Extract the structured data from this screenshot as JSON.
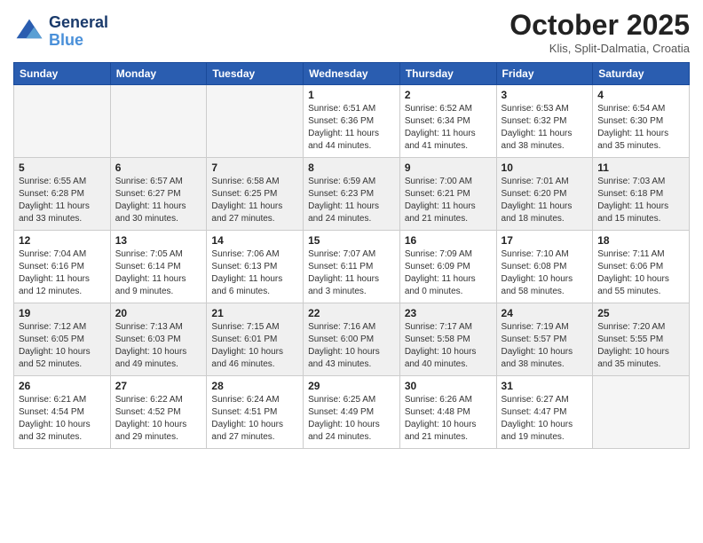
{
  "header": {
    "logo_line1": "General",
    "logo_line2": "Blue",
    "month_title": "October 2025",
    "location": "Klis, Split-Dalmatia, Croatia"
  },
  "days_of_week": [
    "Sunday",
    "Monday",
    "Tuesday",
    "Wednesday",
    "Thursday",
    "Friday",
    "Saturday"
  ],
  "weeks": [
    [
      {
        "day": "",
        "info": ""
      },
      {
        "day": "",
        "info": ""
      },
      {
        "day": "",
        "info": ""
      },
      {
        "day": "1",
        "info": "Sunrise: 6:51 AM\nSunset: 6:36 PM\nDaylight: 11 hours\nand 44 minutes."
      },
      {
        "day": "2",
        "info": "Sunrise: 6:52 AM\nSunset: 6:34 PM\nDaylight: 11 hours\nand 41 minutes."
      },
      {
        "day": "3",
        "info": "Sunrise: 6:53 AM\nSunset: 6:32 PM\nDaylight: 11 hours\nand 38 minutes."
      },
      {
        "day": "4",
        "info": "Sunrise: 6:54 AM\nSunset: 6:30 PM\nDaylight: 11 hours\nand 35 minutes."
      }
    ],
    [
      {
        "day": "5",
        "info": "Sunrise: 6:55 AM\nSunset: 6:28 PM\nDaylight: 11 hours\nand 33 minutes."
      },
      {
        "day": "6",
        "info": "Sunrise: 6:57 AM\nSunset: 6:27 PM\nDaylight: 11 hours\nand 30 minutes."
      },
      {
        "day": "7",
        "info": "Sunrise: 6:58 AM\nSunset: 6:25 PM\nDaylight: 11 hours\nand 27 minutes."
      },
      {
        "day": "8",
        "info": "Sunrise: 6:59 AM\nSunset: 6:23 PM\nDaylight: 11 hours\nand 24 minutes."
      },
      {
        "day": "9",
        "info": "Sunrise: 7:00 AM\nSunset: 6:21 PM\nDaylight: 11 hours\nand 21 minutes."
      },
      {
        "day": "10",
        "info": "Sunrise: 7:01 AM\nSunset: 6:20 PM\nDaylight: 11 hours\nand 18 minutes."
      },
      {
        "day": "11",
        "info": "Sunrise: 7:03 AM\nSunset: 6:18 PM\nDaylight: 11 hours\nand 15 minutes."
      }
    ],
    [
      {
        "day": "12",
        "info": "Sunrise: 7:04 AM\nSunset: 6:16 PM\nDaylight: 11 hours\nand 12 minutes."
      },
      {
        "day": "13",
        "info": "Sunrise: 7:05 AM\nSunset: 6:14 PM\nDaylight: 11 hours\nand 9 minutes."
      },
      {
        "day": "14",
        "info": "Sunrise: 7:06 AM\nSunset: 6:13 PM\nDaylight: 11 hours\nand 6 minutes."
      },
      {
        "day": "15",
        "info": "Sunrise: 7:07 AM\nSunset: 6:11 PM\nDaylight: 11 hours\nand 3 minutes."
      },
      {
        "day": "16",
        "info": "Sunrise: 7:09 AM\nSunset: 6:09 PM\nDaylight: 11 hours\nand 0 minutes."
      },
      {
        "day": "17",
        "info": "Sunrise: 7:10 AM\nSunset: 6:08 PM\nDaylight: 10 hours\nand 58 minutes."
      },
      {
        "day": "18",
        "info": "Sunrise: 7:11 AM\nSunset: 6:06 PM\nDaylight: 10 hours\nand 55 minutes."
      }
    ],
    [
      {
        "day": "19",
        "info": "Sunrise: 7:12 AM\nSunset: 6:05 PM\nDaylight: 10 hours\nand 52 minutes."
      },
      {
        "day": "20",
        "info": "Sunrise: 7:13 AM\nSunset: 6:03 PM\nDaylight: 10 hours\nand 49 minutes."
      },
      {
        "day": "21",
        "info": "Sunrise: 7:15 AM\nSunset: 6:01 PM\nDaylight: 10 hours\nand 46 minutes."
      },
      {
        "day": "22",
        "info": "Sunrise: 7:16 AM\nSunset: 6:00 PM\nDaylight: 10 hours\nand 43 minutes."
      },
      {
        "day": "23",
        "info": "Sunrise: 7:17 AM\nSunset: 5:58 PM\nDaylight: 10 hours\nand 40 minutes."
      },
      {
        "day": "24",
        "info": "Sunrise: 7:19 AM\nSunset: 5:57 PM\nDaylight: 10 hours\nand 38 minutes."
      },
      {
        "day": "25",
        "info": "Sunrise: 7:20 AM\nSunset: 5:55 PM\nDaylight: 10 hours\nand 35 minutes."
      }
    ],
    [
      {
        "day": "26",
        "info": "Sunrise: 6:21 AM\nSunset: 4:54 PM\nDaylight: 10 hours\nand 32 minutes."
      },
      {
        "day": "27",
        "info": "Sunrise: 6:22 AM\nSunset: 4:52 PM\nDaylight: 10 hours\nand 29 minutes."
      },
      {
        "day": "28",
        "info": "Sunrise: 6:24 AM\nSunset: 4:51 PM\nDaylight: 10 hours\nand 27 minutes."
      },
      {
        "day": "29",
        "info": "Sunrise: 6:25 AM\nSunset: 4:49 PM\nDaylight: 10 hours\nand 24 minutes."
      },
      {
        "day": "30",
        "info": "Sunrise: 6:26 AM\nSunset: 4:48 PM\nDaylight: 10 hours\nand 21 minutes."
      },
      {
        "day": "31",
        "info": "Sunrise: 6:27 AM\nSunset: 4:47 PM\nDaylight: 10 hours\nand 19 minutes."
      },
      {
        "day": "",
        "info": ""
      }
    ]
  ]
}
